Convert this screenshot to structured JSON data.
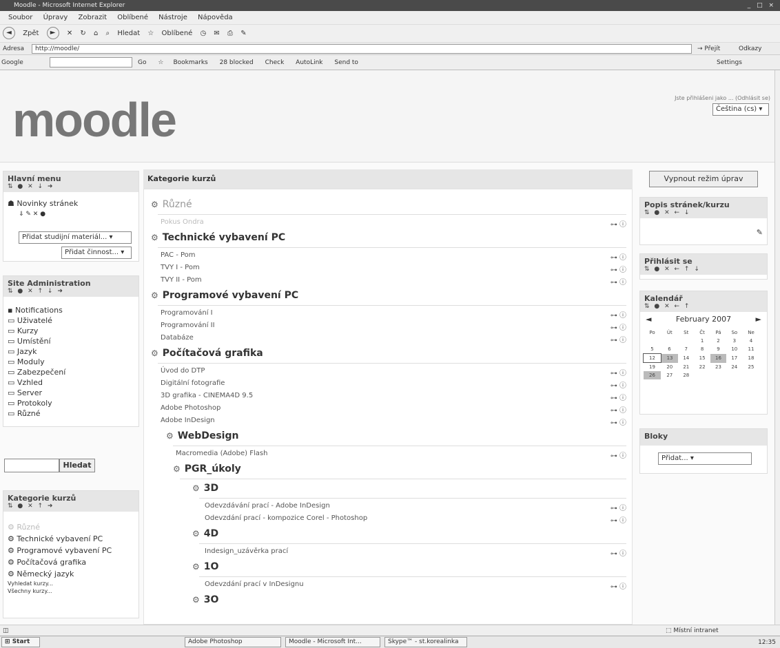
{
  "window": {
    "title": "Moodle - Microsoft Internet Explorer",
    "controls": "_ □ ×"
  },
  "menubar": [
    "Soubor",
    "Úpravy",
    "Zobrazit",
    "Oblíbené",
    "Nástroje",
    "Nápověda"
  ],
  "toolbar": {
    "back": "Zpět",
    "search": "Hledat",
    "favorites": "Oblíbené"
  },
  "address": {
    "label": "Adresa",
    "url": "http://moodle/",
    "go": "Přejít",
    "links": "Odkazy"
  },
  "google": {
    "label": "Google",
    "go": "Go",
    "bookmarks": "Bookmarks",
    "blocked": "28 blocked",
    "check": "Check",
    "autolink": "AutoLink",
    "sendto": "Send to",
    "settings": "Settings"
  },
  "header": {
    "logo": "moodle",
    "logged_in": "Jste přihlášeni jako ... (Odhlásit se)",
    "language": "Čeština (cs)"
  },
  "left": {
    "main_menu": {
      "title": "Hlavní menu",
      "ctl": "⇅ ● ✕ ↓ ➜",
      "news": "Novinky stránek",
      "news_ctl": "⇓ ✎ ✕ ●",
      "add_resource": "Přidat studijní materiál...",
      "add_activity": "Přidat činnost..."
    },
    "admin": {
      "title": "Site Administration",
      "ctl": "⇅ ● ✕ ↑ ↓ ➜",
      "items": [
        "Notifications",
        "Uživatelé",
        "Kurzy",
        "Umístění",
        "Jazyk",
        "Moduly",
        "Zabezpečení",
        "Vzhled",
        "Server",
        "Protokoly",
        "Různé"
      ]
    },
    "search": {
      "button": "Hledat"
    },
    "courses": {
      "title": "Kategorie kurzů",
      "ctl": "⇅ ● ✕ ↑ ➜",
      "items": [
        "Různé",
        "Technické vybavení PC",
        "Programové vybavení PC",
        "Počítačová grafika",
        "Německý jazyk"
      ],
      "search": "Vyhledat kurzy...",
      "all": "Všechny kurzy..."
    }
  },
  "main": {
    "title": "Kategorie kurzů",
    "categories": [
      {
        "name": "Různé",
        "courses": [
          "Pokus Ondra"
        ]
      },
      {
        "name": "Technické vybavení PC",
        "courses": [
          "PAC - Pom",
          "TVY I - Pom",
          "TVY II - Pom"
        ]
      },
      {
        "name": "Programové vybavení PC",
        "courses": [
          "Programování I",
          "Programování II",
          "Databáze"
        ]
      },
      {
        "name": "Počítačová grafika",
        "courses": [
          "Úvod do DTP",
          "Digitální fotografie",
          "3D grafika - CINEMA4D 9.5",
          "Adobe Photoshop",
          "Adobe InDesign"
        ]
      }
    ],
    "sub_webdesign": {
      "name": "WebDesign",
      "courses": [
        "Macromedia (Adobe) Flash"
      ]
    },
    "sub_pgr": {
      "name": "PGR_úkoly"
    },
    "sub_3d": {
      "name": "3D",
      "courses": [
        "Odevzdávání prací - Adobe InDesign",
        "Odevzdání prací - kompozice Corel - Photoshop"
      ]
    },
    "sub_4d": {
      "name": "4D",
      "courses": [
        "Indesign_uzávěrka prací"
      ]
    },
    "sub_1o": {
      "name": "1O",
      "courses": [
        "Odevzdání prací v InDesignu"
      ]
    },
    "sub_3o": {
      "name": "3O"
    },
    "course_icons": "⊶ ⓘ"
  },
  "right": {
    "edit_button": "Vypnout režim úprav",
    "summary": {
      "title": "Popis stránek/kurzu",
      "ctl": "⇅ ● ✕ ← ↓"
    },
    "login": {
      "title": "Přihlásit se",
      "ctl": "⇅ ● ✕ ← ↑ ↓"
    },
    "calendar": {
      "title": "Kalendář",
      "ctl": "⇅ ● ✕ ← ↑",
      "month": "February 2007",
      "days": [
        "Po",
        "Út",
        "St",
        "Čt",
        "Pá",
        "So",
        "Ne"
      ],
      "weeks": [
        [
          "",
          "",
          "",
          "1",
          "2",
          "3",
          "4"
        ],
        [
          "5",
          "6",
          "7",
          "8",
          "9",
          "10",
          "11"
        ],
        [
          "12",
          "13",
          "14",
          "15",
          "16",
          "17",
          "18"
        ],
        [
          "19",
          "20",
          "21",
          "22",
          "23",
          "24",
          "25"
        ],
        [
          "26",
          "27",
          "28",
          "",
          "",
          "",
          ""
        ]
      ]
    },
    "blocks": {
      "title": "Bloky",
      "select": "Přidat..."
    }
  },
  "status": {
    "zone": "Místní intranet"
  },
  "taskbar": {
    "start": "Start",
    "items": [
      "Adobe Photoshop",
      "Moodle - Microsoft Int...",
      "Skype™ - st.korealinka"
    ],
    "clock": "12:35"
  }
}
